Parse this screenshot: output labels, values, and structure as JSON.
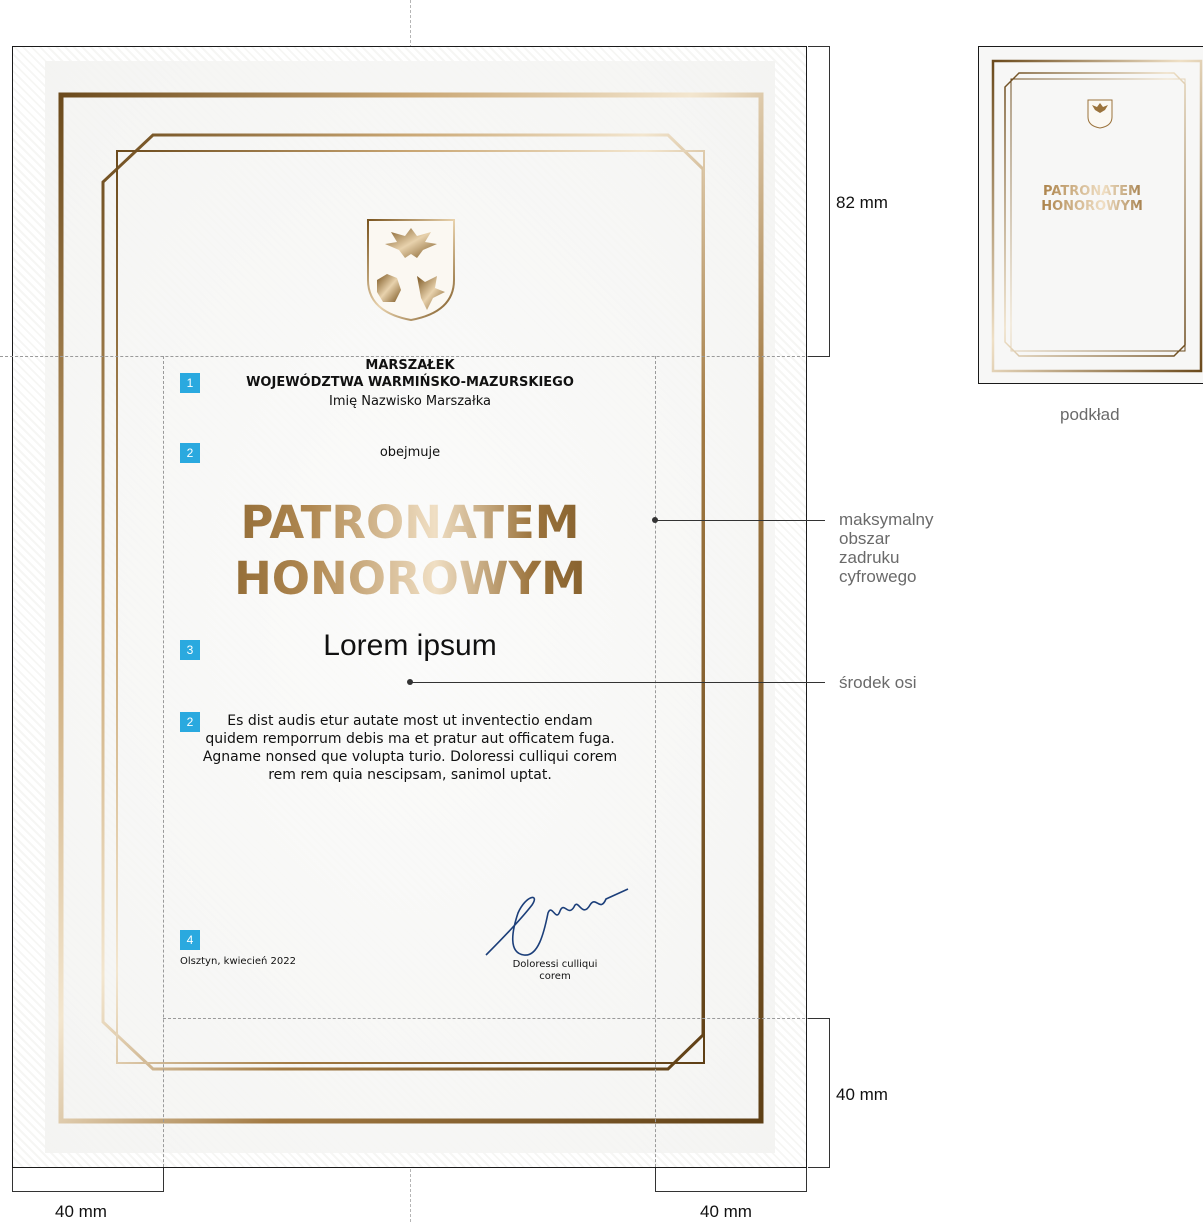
{
  "certificate": {
    "badges": [
      "1",
      "2",
      "3",
      "2",
      "4"
    ],
    "issuer_title": "MARSZAŁEK",
    "issuer_office": "WOJEWÓDZTWA WARMIŃSKO-MAZURSKIEGO",
    "issuer_name": "Imię Nazwisko Marszałka",
    "verb": "obejmuje",
    "title_line1": "PATRONATEM",
    "title_line2": "HONOROWYM",
    "subject": "Lorem ipsum",
    "body_line1": "Es dist audis etur autate most ut inventectio endam",
    "body_line2": "quidem remporrum debis ma et pratur aut officatem fuga.",
    "body_line3": "Agname nonsed que volupta turio. Doloressi culliqui corem",
    "body_line4": "rem rem quia nescipsam, sanimol uptat.",
    "place_date": "Olsztyn, kwiecień 2022",
    "signatory_line1": "Doloressi culliqui",
    "signatory_line2": "corem"
  },
  "annotations": {
    "top_margin": "82 mm",
    "bottom_margin": "40 mm",
    "left_margin": "40 mm",
    "right_margin": "40 mm",
    "print_area_line1": "maksymalny",
    "print_area_line2": "obszar",
    "print_area_line3": "zadruku",
    "print_area_line4": "cyfrowego",
    "axis_center": "środek osi",
    "background_caption": "podkład"
  },
  "thumbnail": {
    "title_line1": "PATRONATEM",
    "title_line2": "HONOROWYM"
  },
  "colors": {
    "gold_dark": "#7a5520",
    "gold_light": "#f0dfc4",
    "badge_blue": "#2aa9df",
    "signature_blue": "#1c3f7a"
  }
}
